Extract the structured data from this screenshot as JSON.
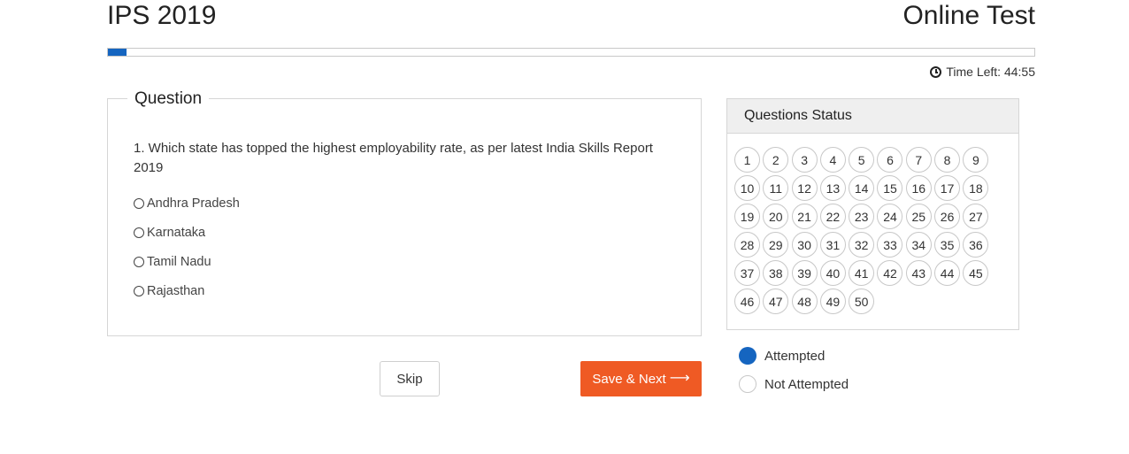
{
  "header": {
    "title": "IPS 2019",
    "right_title": "Online Test"
  },
  "progress": {
    "value": 0.02,
    "color": "#1565c0"
  },
  "timer": {
    "label": "Time Left: 44:55",
    "icon": "clock-icon"
  },
  "question": {
    "legend": "Question",
    "text": "1. Which state has topped the highest employability rate, as per latest India Skills Report 2019",
    "options": [
      "Andhra Pradesh",
      "Karnataka",
      "Tamil Nadu",
      "Rajasthan"
    ]
  },
  "buttons": {
    "skip": "Skip",
    "next": "Save & Next",
    "next_icon": "arrow-right-icon",
    "next_color": "#ef5a24"
  },
  "status": {
    "title": "Questions Status",
    "numbers": [
      "1",
      "2",
      "3",
      "4",
      "5",
      "6",
      "7",
      "8",
      "9",
      "10",
      "11",
      "12",
      "13",
      "14",
      "15",
      "16",
      "17",
      "18",
      "19",
      "20",
      "21",
      "22",
      "23",
      "24",
      "25",
      "26",
      "27",
      "28",
      "29",
      "30",
      "31",
      "32",
      "33",
      "34",
      "35",
      "36",
      "37",
      "38",
      "39",
      "40",
      "41",
      "42",
      "43",
      "44",
      "45",
      "46",
      "47",
      "48",
      "49",
      "50"
    ]
  },
  "legend": {
    "attempted": "Attempted",
    "not_attempted": "Not Attempted",
    "attempted_color": "#1565c0"
  }
}
